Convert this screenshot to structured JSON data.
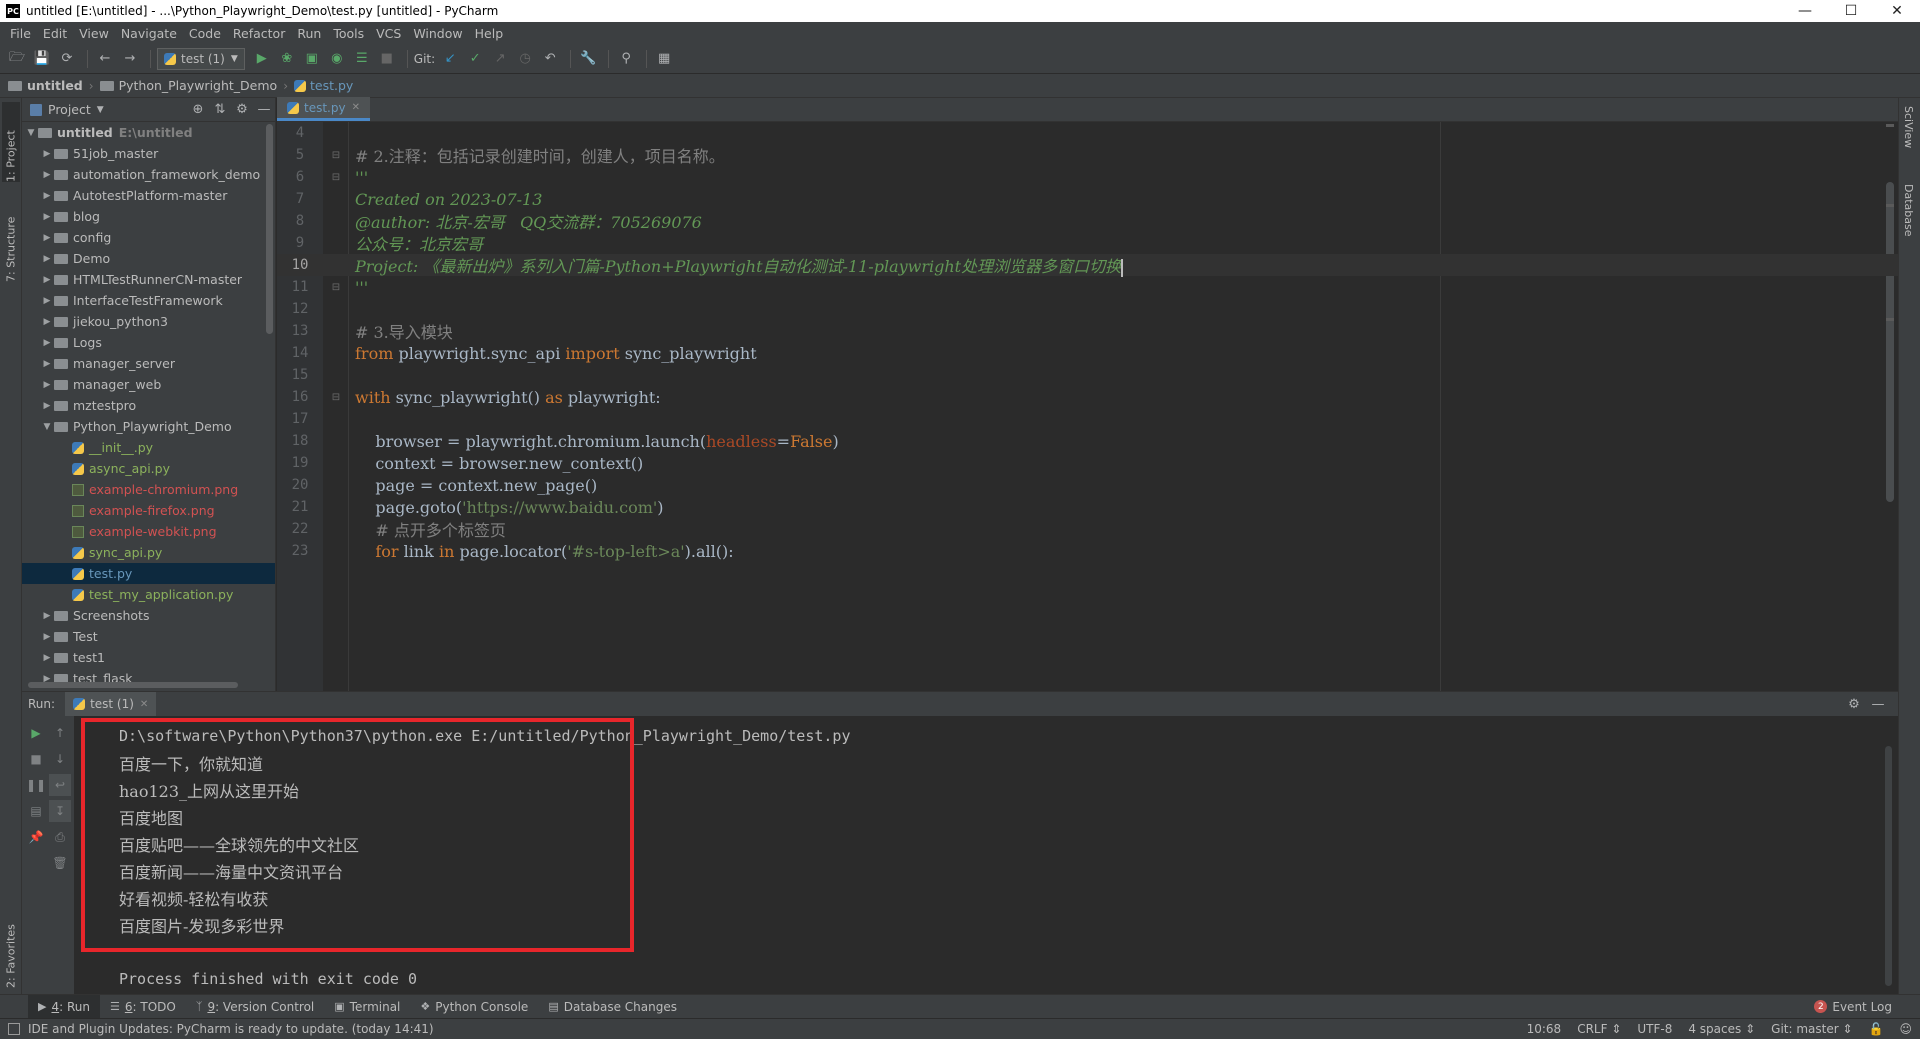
{
  "window": {
    "title": "untitled [E:\\untitled] - ...\\Python_Playwright_Demo\\test.py [untitled] - PyCharm",
    "logo": "PC",
    "buttons": [
      "minimize",
      "maximize",
      "close"
    ]
  },
  "menu": [
    "File",
    "Edit",
    "View",
    "Navigate",
    "Code",
    "Refactor",
    "Run",
    "Tools",
    "VCS",
    "Window",
    "Help"
  ],
  "toolbar": {
    "run_config": "test (1)",
    "git_label": "Git:"
  },
  "breadcrumb": [
    "untitled",
    "Python_Playwright_Demo",
    "test.py"
  ],
  "left_strip": {
    "project_tab": "1: Project",
    "structure_tab": "7: Structure",
    "favorites_tab": "2: Favorites"
  },
  "right_strip": {
    "sciview_tab": "SciView",
    "database_tab": "Database"
  },
  "project_panel": {
    "title": "Project",
    "root": {
      "name": "untitled",
      "path": "E:\\untitled"
    },
    "folders_top": [
      "51job_master",
      "automation_framework_demo",
      "AutotestPlatform-master",
      "blog",
      "config",
      "Demo",
      "HTMLTestRunnerCN-master",
      "InterfaceTestFramework",
      "jiekou_python3",
      "Logs",
      "manager_server",
      "manager_web",
      "mztestpro"
    ],
    "open_folder": "Python_Playwright_Demo",
    "files": [
      {
        "name": "__init__.py",
        "kind": "py",
        "color": "green"
      },
      {
        "name": "async_api.py",
        "kind": "py",
        "color": "green"
      },
      {
        "name": "example-chromium.png",
        "kind": "img",
        "color": "red"
      },
      {
        "name": "example-firefox.png",
        "kind": "img",
        "color": "red"
      },
      {
        "name": "example-webkit.png",
        "kind": "img",
        "color": "red"
      },
      {
        "name": "sync_api.py",
        "kind": "py",
        "color": "green"
      },
      {
        "name": "test.py",
        "kind": "py",
        "color": "blue",
        "selected": true
      },
      {
        "name": "test_my_application.py",
        "kind": "py",
        "color": "green"
      }
    ],
    "folders_bottom": [
      "Screenshots",
      "Test",
      "test1",
      "test_flask"
    ]
  },
  "editor": {
    "tab": "test.py",
    "current_line": "10",
    "lines": [
      {
        "n": "4",
        "fold": "",
        "html": ""
      },
      {
        "n": "5",
        "fold": "⊟",
        "html": "<span class=\"tk-comment\"># 2.注释：包括记录创建时间，创建人，项目名称。</span>"
      },
      {
        "n": "6",
        "fold": "⊟",
        "html": "<span class=\"tk-doc\">'''</span>"
      },
      {
        "n": "7",
        "fold": "",
        "html": "<span class=\"tk-doc\">Created on 2023-07-13</span>"
      },
      {
        "n": "8",
        "fold": "",
        "html": "<span class=\"tk-doc\">@author: 北京-宏哥   QQ交流群：705269076</span>"
      },
      {
        "n": "9",
        "fold": "",
        "html": "<span class=\"tk-doc\">公众号：北京宏哥</span>"
      },
      {
        "n": "10",
        "fold": "",
        "html": "<span class=\"tk-doc\">Project: 《最新出炉》系列入门篇-Python+Playwright自动化测试-11-playwright处理浏览器多窗口切换</span><span class=\"caret\"></span>"
      },
      {
        "n": "11",
        "fold": "⊟",
        "html": "<span class=\"tk-doc\">'''</span>"
      },
      {
        "n": "12",
        "fold": "",
        "html": ""
      },
      {
        "n": "13",
        "fold": "",
        "html": "<span class=\"tk-comment\"># 3.导入模块</span>"
      },
      {
        "n": "14",
        "fold": "",
        "html": "<span class=\"tk-kw\">from</span> playwright.sync_api <span class=\"tk-kw\">import</span> sync_playwright"
      },
      {
        "n": "15",
        "fold": "",
        "html": ""
      },
      {
        "n": "16",
        "fold": "⊟",
        "html": "<span class=\"tk-kw\">with</span> sync_playwright() <span class=\"tk-kw\">as</span> playwright:"
      },
      {
        "n": "17",
        "fold": "",
        "html": ""
      },
      {
        "n": "18",
        "fold": "",
        "html": "    browser = playwright.chromium.launch(<span class=\"tk-param\">headless</span>=<span class=\"tk-kwval\">False</span>)"
      },
      {
        "n": "19",
        "fold": "",
        "html": "    context = browser.new_context()"
      },
      {
        "n": "20",
        "fold": "",
        "html": "    page = context.new_page()"
      },
      {
        "n": "21",
        "fold": "",
        "html": "    page.goto(<span class=\"tk-str\">'https://www.baidu.com'</span>)"
      },
      {
        "n": "22",
        "fold": "",
        "html": "    <span class=\"tk-comment\"># 点开多个标签页</span>"
      },
      {
        "n": "23",
        "fold": "",
        "html": "    <span class=\"tk-kw\">for</span> link <span class=\"tk-kw\">in</span> page.locator(<span class=\"tk-str\">'#s-top-left>a'</span>).all():"
      }
    ]
  },
  "run_panel": {
    "label": "Run:",
    "tab": "test (1)",
    "command": "D:\\software\\Python\\Python37\\python.exe E:/untitled/Python_Playwright_Demo/test.py",
    "output": [
      "百度一下，你就知道",
      "hao123_上网从这里开始",
      "百度地图",
      "百度贴吧——全球领先的中文社区",
      "百度新闻——海量中文资讯平台",
      "好看视频-轻松有收获",
      "百度图片-发现多彩世界"
    ],
    "exit_message": "Process finished with exit code 0"
  },
  "bottom_tabs": [
    {
      "num": "4",
      "label": ": Run",
      "icon": "play-icon"
    },
    {
      "num": "6",
      "label": ": TODO",
      "icon": "list-icon"
    },
    {
      "num": "9",
      "label": ": Version Control",
      "icon": "branch-icon"
    },
    {
      "num": "",
      "label": "Terminal",
      "icon": "terminal-icon"
    },
    {
      "num": "",
      "label": "Python Console",
      "icon": "python-icon"
    },
    {
      "num": "",
      "label": "Database Changes",
      "icon": "database-icon"
    }
  ],
  "event_log": {
    "label": "Event Log",
    "count": "2"
  },
  "status_bar": {
    "message": "IDE and Plugin Updates: PyCharm is ready to update. (today 14:41)",
    "position": "10:68",
    "line_sep": "CRLF",
    "encoding": "UTF-8",
    "indent": "4 spaces",
    "git": "Git: master"
  },
  "colors": {
    "background": "#2b2b2b",
    "panel": "#3c3f41",
    "highlight_box": "#e8262b",
    "selection": "#0d293e",
    "accent": "#4a88c7"
  }
}
